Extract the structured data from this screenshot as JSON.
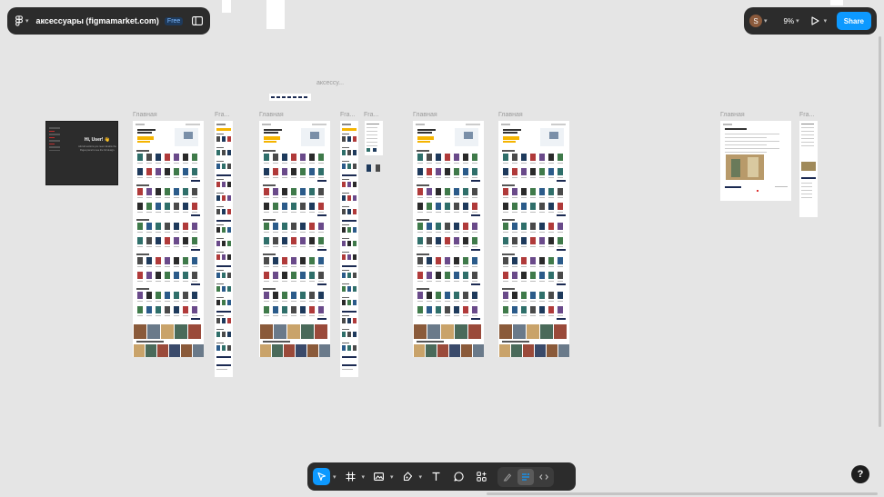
{
  "file": {
    "title": "аксессуары (figmamarket.com)",
    "plan_badge": "Free"
  },
  "header": {
    "user_initial": "S",
    "zoom": "9%",
    "share_label": "Share"
  },
  "help_label": "?",
  "canvas": {
    "frames": [
      {
        "label": "",
        "kind": "welcome"
      },
      {
        "label": "Главная",
        "kind": "page"
      },
      {
        "label": "Fra...",
        "kind": "mobile"
      },
      {
        "label": "Главная",
        "kind": "page"
      },
      {
        "label": "Fra...",
        "kind": "mobile"
      },
      {
        "label": "Fra...",
        "kind": "small"
      },
      {
        "label": "Главная",
        "kind": "page"
      },
      {
        "label": "Главная",
        "kind": "page"
      },
      {
        "label": "Главная",
        "kind": "article"
      },
      {
        "label": "Fra...",
        "kind": "mobile-short"
      }
    ],
    "note_label": "аксессу...",
    "welcome": {
      "heading": "Hi, User! 👋",
      "body": "Add all sections you need. Enable the Pages panel to see the full design."
    }
  },
  "toolbar": {
    "tools": [
      {
        "icon": "move-icon",
        "active": true,
        "dropdown": true
      },
      {
        "icon": "frame-icon",
        "active": false,
        "dropdown": true
      },
      {
        "icon": "image-icon",
        "active": false,
        "dropdown": true
      },
      {
        "icon": "pen-icon",
        "active": false,
        "dropdown": true
      },
      {
        "icon": "text-icon",
        "active": false,
        "dropdown": false
      },
      {
        "icon": "comment-icon",
        "active": false,
        "dropdown": false
      },
      {
        "icon": "actions-icon",
        "active": false,
        "dropdown": false
      }
    ],
    "modes": [
      {
        "icon": "draw-mode-icon",
        "active": false
      },
      {
        "icon": "design-mode-icon",
        "active": true
      },
      {
        "icon": "dev-mode-icon",
        "active": false
      }
    ]
  },
  "colors": {
    "toolbar_bg": "#2c2c2c",
    "accent": "#0d99ff",
    "canvas_bg": "#e5e5e5",
    "promo_yellow": "#f5b400",
    "navy": "#1b2a52"
  }
}
